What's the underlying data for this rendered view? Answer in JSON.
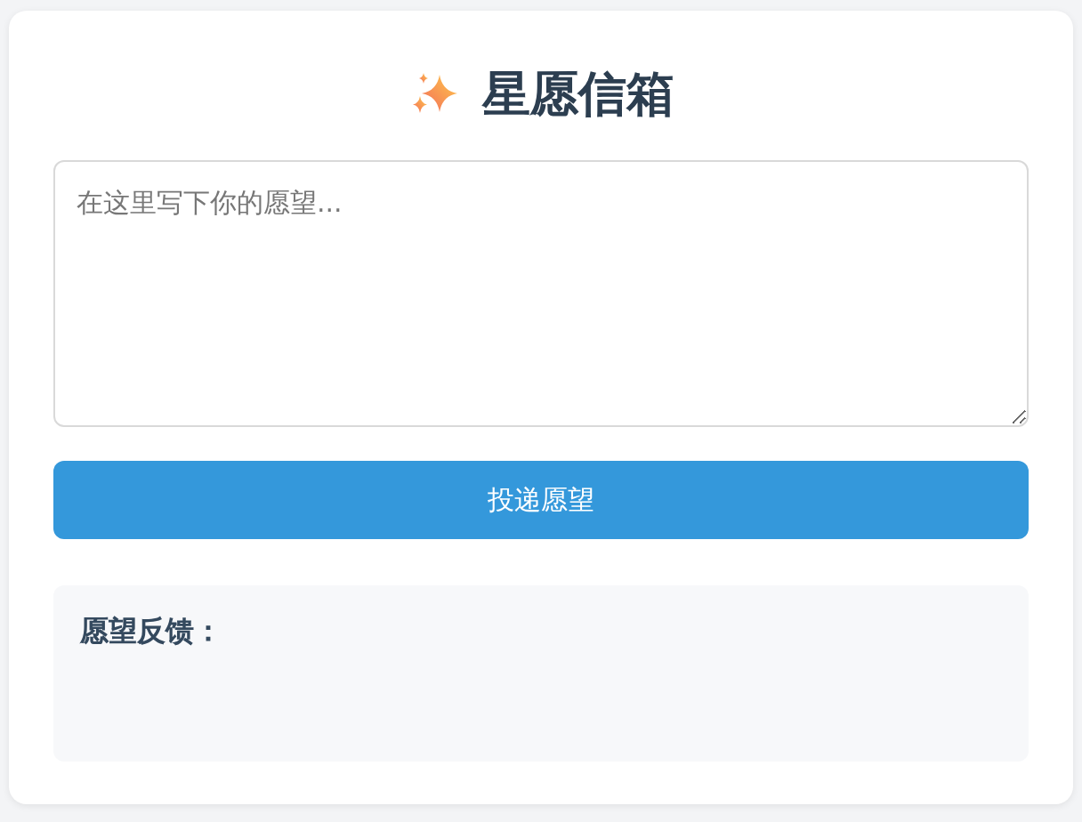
{
  "title": "星愿信箱",
  "wish_field": {
    "placeholder": "在这里写下你的愿望..."
  },
  "submit_button": {
    "label": "投递愿望"
  },
  "feedback": {
    "heading": "愿望反馈："
  }
}
